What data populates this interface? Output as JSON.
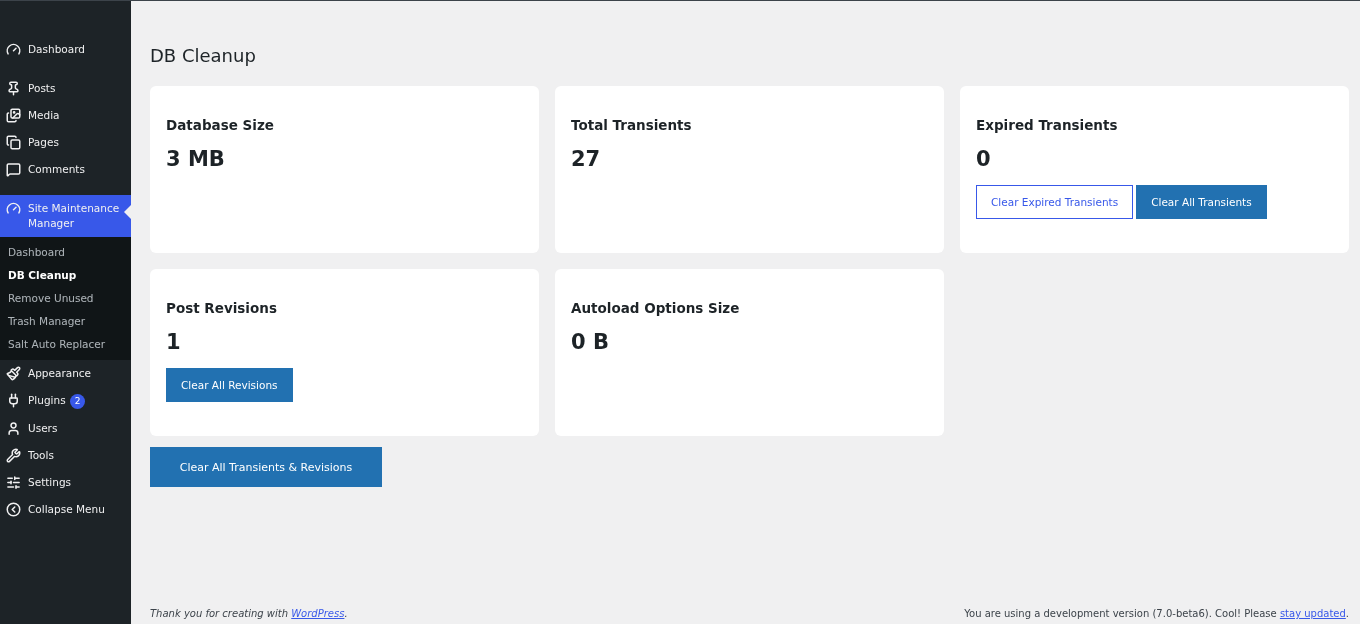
{
  "sidebar": {
    "groups": [
      {
        "items": [
          {
            "label": "Dashboard",
            "kind": "gauge",
            "selected": false
          }
        ]
      },
      {
        "items": [
          {
            "label": "Posts",
            "kind": "pin",
            "selected": false
          },
          {
            "label": "Media",
            "kind": "media",
            "selected": false
          },
          {
            "label": "Pages",
            "kind": "pages",
            "selected": false
          },
          {
            "label": "Comments",
            "kind": "comment",
            "selected": false
          }
        ]
      },
      {
        "items": [
          {
            "label": "Site Maintenance Manager",
            "kind": "gauge",
            "selected": true,
            "children": [
              {
                "label": "Dashboard",
                "selected": false
              },
              {
                "label": "DB Cleanup",
                "selected": true
              },
              {
                "label": "Remove Unused",
                "selected": false
              },
              {
                "label": "Trash Manager",
                "selected": false
              },
              {
                "label": "Salt Auto Replacer",
                "selected": false
              }
            ]
          },
          {
            "label": "Appearance",
            "kind": "brush",
            "selected": false
          },
          {
            "label": "Plugins",
            "kind": "plug",
            "selected": false,
            "badge": "2"
          },
          {
            "label": "Users",
            "kind": "user",
            "selected": false
          },
          {
            "label": "Tools",
            "kind": "wrench",
            "selected": false
          },
          {
            "label": "Settings",
            "kind": "sliders",
            "selected": false
          },
          {
            "label": "Collapse Menu",
            "kind": "collapse",
            "selected": false
          }
        ]
      }
    ]
  },
  "page_title": "DB Cleanup",
  "cards": [
    {
      "title": "Database Size",
      "value": "3 MB"
    },
    {
      "title": "Total Transients",
      "value": "27"
    },
    {
      "title": "Expired Transients",
      "value": "0",
      "buttons": [
        {
          "label": "Clear Expired Transients",
          "kind": "outline"
        },
        {
          "label": "Clear All Transients",
          "kind": "primary"
        }
      ]
    },
    {
      "title": "Post Revisions",
      "value": "1",
      "buttons": [
        {
          "label": "Clear All Revisions",
          "kind": "primary"
        }
      ]
    },
    {
      "title": "Autoload Options Size",
      "value": "0 B"
    }
  ],
  "main_button": "Clear All Transients & Revisions",
  "footer": {
    "left": {
      "before": "Thank you for creating with ",
      "link": "WordPress",
      "after": "."
    },
    "right": {
      "before": "You are using a development version (7.0-beta6). Cool! Please ",
      "link": "stay updated",
      "after": "."
    }
  }
}
